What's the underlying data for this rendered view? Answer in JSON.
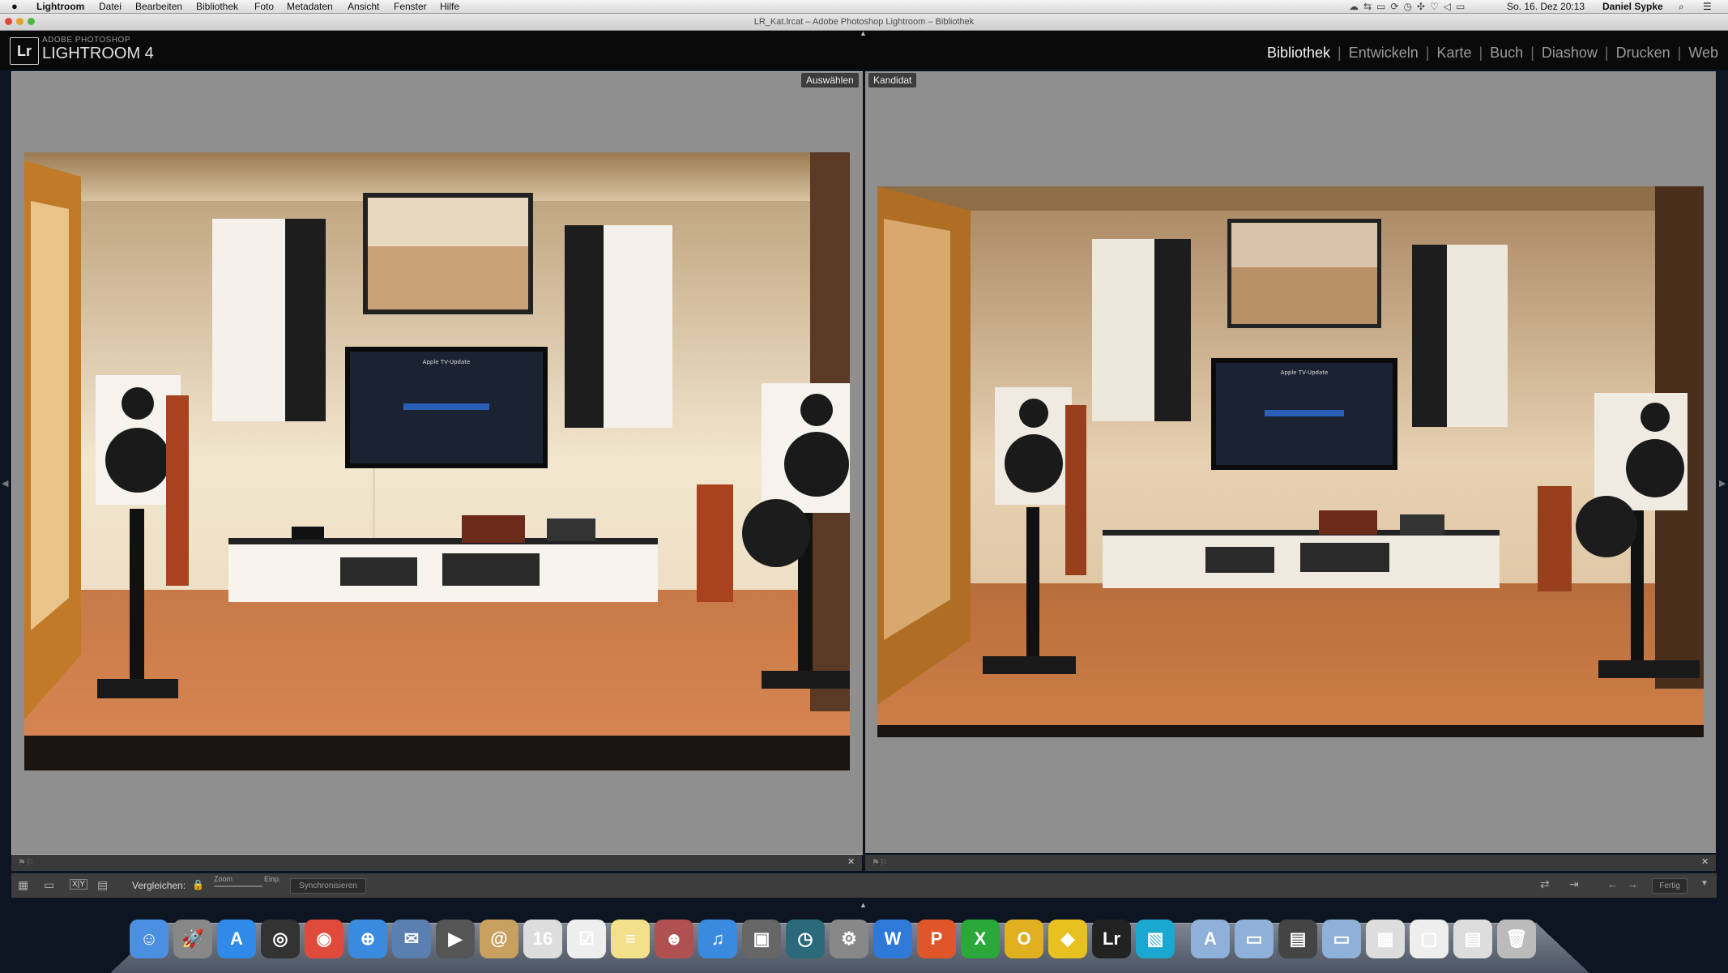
{
  "menubar": {
    "app": "Lightroom",
    "items": [
      "Datei",
      "Bearbeiten",
      "Bibliothek",
      "Foto",
      "Metadaten",
      "Ansicht",
      "Fenster",
      "Hilfe"
    ],
    "clock": "So. 16. Dez  20:13",
    "user": "Daniel Sypke"
  },
  "window": {
    "title": "LR_Kat.lrcat – Adobe Photoshop Lightroom – Bibliothek"
  },
  "brand": {
    "logo": "Lr",
    "small": "ADOBE PHOTOSHOP",
    "big": "LIGHTROOM 4"
  },
  "modules": [
    {
      "label": "Bibliothek",
      "active": true
    },
    {
      "label": "Entwickeln",
      "active": false
    },
    {
      "label": "Karte",
      "active": false
    },
    {
      "label": "Buch",
      "active": false
    },
    {
      "label": "Diashow",
      "active": false
    },
    {
      "label": "Drucken",
      "active": false
    },
    {
      "label": "Web",
      "active": false
    }
  ],
  "compare": {
    "select_tag": "Auswählen",
    "candidate_tag": "Kandidat"
  },
  "toolbar": {
    "compare_label": "Vergleichen:",
    "zoom_label": "Zoom",
    "fit_label": "Einp.",
    "sync_button": "Synchronisieren",
    "done_button": "Fertig"
  },
  "dock": {
    "icons": [
      {
        "name": "finder-icon",
        "glyph": "☺",
        "color": "#4a8fe0"
      },
      {
        "name": "launchpad-icon",
        "glyph": "🚀",
        "color": "#888"
      },
      {
        "name": "app-store-icon",
        "glyph": "A",
        "color": "#2f8ae8"
      },
      {
        "name": "dashboard-icon",
        "glyph": "◎",
        "color": "#333"
      },
      {
        "name": "chrome-icon",
        "glyph": "◉",
        "color": "#e04a3a"
      },
      {
        "name": "safari-icon",
        "glyph": "⊕",
        "color": "#3a8ae0"
      },
      {
        "name": "mail-bird-icon",
        "glyph": "✉",
        "color": "#5a7fb0"
      },
      {
        "name": "facetime-icon",
        "glyph": "▶",
        "color": "#555"
      },
      {
        "name": "contacts-icon",
        "glyph": "@",
        "color": "#c8a060"
      },
      {
        "name": "calendar-icon",
        "glyph": "16",
        "color": "#ddd"
      },
      {
        "name": "reminders-icon",
        "glyph": "☑",
        "color": "#eee"
      },
      {
        "name": "notes-icon",
        "glyph": "≡",
        "color": "#f3e08a"
      },
      {
        "name": "photo-booth-icon",
        "glyph": "☻",
        "color": "#b05050"
      },
      {
        "name": "itunes-icon",
        "glyph": "♫",
        "color": "#3a8ae0"
      },
      {
        "name": "iphoto-icon",
        "glyph": "▣",
        "color": "#666"
      },
      {
        "name": "time-machine-icon",
        "glyph": "◷",
        "color": "#2a6a7a"
      },
      {
        "name": "system-preferences-icon",
        "glyph": "⚙",
        "color": "#888"
      },
      {
        "name": "word-icon",
        "glyph": "W",
        "color": "#2f7ad8"
      },
      {
        "name": "powerpoint-icon",
        "glyph": "P",
        "color": "#e0562a"
      },
      {
        "name": "excel-icon",
        "glyph": "X",
        "color": "#2aa83a"
      },
      {
        "name": "outlook-icon",
        "glyph": "O",
        "color": "#e0b020"
      },
      {
        "name": "cyberduck-icon",
        "glyph": "◆",
        "color": "#e8c020"
      },
      {
        "name": "lightroom-icon",
        "glyph": "Lr",
        "color": "#222"
      },
      {
        "name": "preview-icon",
        "glyph": "▧",
        "color": "#1aa8d0"
      },
      {
        "name": "applications-folder-icon",
        "glyph": "A",
        "color": "#8fb0d8"
      },
      {
        "name": "documents-folder-icon",
        "glyph": "▭",
        "color": "#8fb0d8"
      },
      {
        "name": "activity-stack-icon",
        "glyph": "▤",
        "color": "#444"
      },
      {
        "name": "folder-icon",
        "glyph": "▭",
        "color": "#8fb0d8"
      },
      {
        "name": "downloads-stack-icon",
        "glyph": "▦",
        "color": "#ddd"
      },
      {
        "name": "desktop-stack-icon",
        "glyph": "▢",
        "color": "#eee"
      },
      {
        "name": "files-stack-icon",
        "glyph": "▤",
        "color": "#ddd"
      },
      {
        "name": "trash-icon",
        "glyph": "🗑",
        "color": "#bbb"
      }
    ]
  }
}
